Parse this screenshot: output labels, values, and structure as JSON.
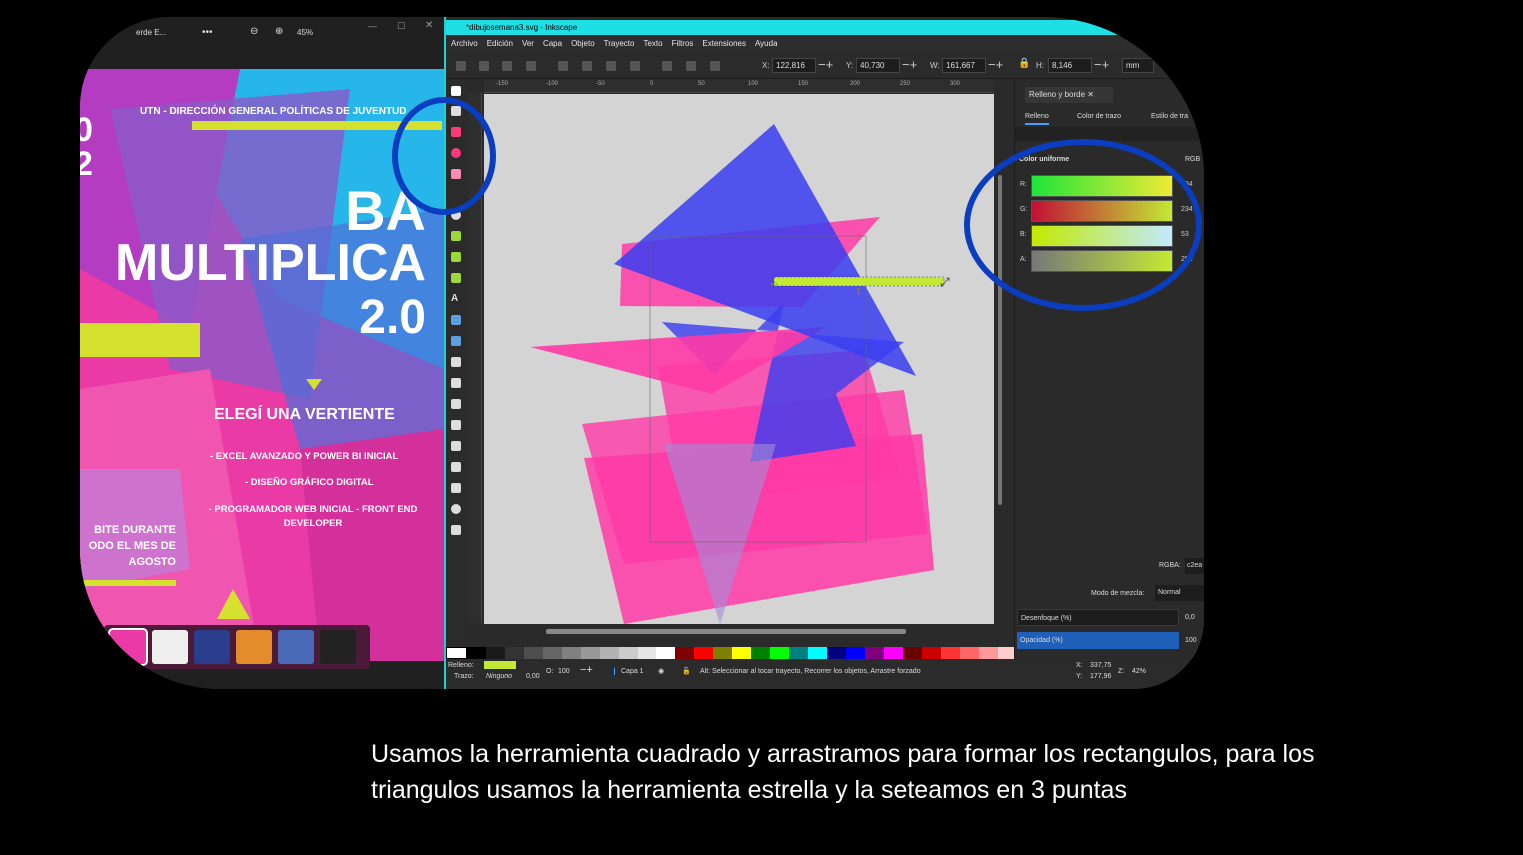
{
  "viewer": {
    "filename": "erde E...",
    "more_label": "•••",
    "zoom": "45%"
  },
  "poster": {
    "org": "UTN - DIRECCIÓN GENERAL POLÍTICAS DE JUVENTUD",
    "side_digits": [
      "0",
      "2"
    ],
    "title_line1": "BA",
    "title_line2": "MULTIPLICA",
    "title_line3": "2.0",
    "subtitle": "ELEGÍ UNA VERTIENTE",
    "items": [
      "- EXCEL AVANZADO Y POWER BI INICIAL",
      "- DISEÑO GRÁFICO DIGITAL",
      "- PROGRAMADOR WEB INICIAL - FRONT END DEVELOPER"
    ],
    "cta": [
      "BITE DURANTE",
      "ODO EL MES DE",
      "AGOSTO"
    ]
  },
  "inkscape": {
    "title": "*dibujosemana3.svg - Inkscape",
    "menu": [
      "Archivo",
      "Edición",
      "Ver",
      "Capa",
      "Objeto",
      "Trayecto",
      "Texto",
      "Filtros",
      "Extensiones",
      "Ayuda"
    ],
    "x_label": "X:",
    "x_value": "122,816",
    "y_label": "Y:",
    "y_value": "40,730",
    "w_label": "W:",
    "w_value": "161,667",
    "h_label": "H:",
    "h_value": "8,146",
    "unit": "mm",
    "ruler_ticks": [
      "-150",
      "-100",
      "-50",
      "0",
      "50",
      "100",
      "150",
      "200",
      "250",
      "300"
    ],
    "status": {
      "fill_label": "Relleno:",
      "stroke_label": "Trazo:",
      "stroke_value": "Ninguno",
      "stroke_width": "0,00",
      "opacity_label": "O:",
      "opacity_value": "100",
      "layer": "Capa 1",
      "hint": "Alt: Seleccionar al tocar trayecto, Recorrer los objetos, Arrastre forzado",
      "x_label": "X:",
      "x": "337,75",
      "y_label": "Y:",
      "y": "177,96",
      "z_label": "Z:",
      "zoom": "42%"
    },
    "panel": {
      "tab": "Relleno y borde",
      "fill_tab": "Relleno",
      "stroke_color_tab": "Color de trazo",
      "stroke_style_tab": "Estilo de tra",
      "mode_label": "Color uniforme",
      "color_model": "RGB",
      "r_label": "R:",
      "r_value": "194",
      "g_label": "G:",
      "g_value": "234",
      "b_label": "B:",
      "b_value": "53",
      "a_label": "A:",
      "a_value": "255",
      "rgba_label": "RGBA:",
      "rgba_value": "c2ea",
      "blend_label": "Modo de mezcla:",
      "blend_value": "Normal",
      "blur_label": "Desenfoque (%)",
      "blur_value": "0,0",
      "opacity_label": "Opacidad (%)",
      "opacity_value": "100"
    }
  },
  "colors": {
    "magenta": "#ff3aa6",
    "blue": "#3a3df0",
    "lime": "#c2ea35",
    "cyan": "#1ee0e4",
    "annotation": "#0a3dbf"
  },
  "caption": "Usamos la herramienta cuadrado y arrastramos para formar los rectangulos, para los triangulos usamos la herramienta estrella y la seteamos en 3 puntas"
}
